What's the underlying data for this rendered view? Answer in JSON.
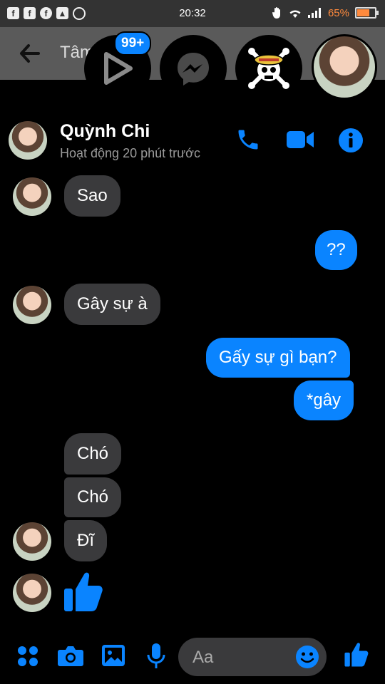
{
  "status_bar": {
    "time": "20:32",
    "battery_percent": "65%",
    "battery_level": 0.65,
    "notification_icons": [
      "facebook-icon",
      "facebook-icon",
      "facebook-circle-icon",
      "image-icon",
      "messenger-icon"
    ]
  },
  "top_bar": {
    "title": "Tâm",
    "badge_count": "99+"
  },
  "conversation": {
    "name": "Quỳnh Chi",
    "status": "Hoạt động 20 phút trước"
  },
  "messages": [
    {
      "dir": "in",
      "text": "Sao"
    },
    {
      "dir": "out",
      "text": "??"
    },
    {
      "dir": "in",
      "text": "Gây sự à"
    },
    {
      "dir": "out",
      "text": "Gấy sự gì bạn?"
    },
    {
      "dir": "out",
      "text": "*gây"
    },
    {
      "dir": "in",
      "text": "Chó"
    },
    {
      "dir": "in",
      "text": "Chó"
    },
    {
      "dir": "in",
      "text": "Đĩ"
    },
    {
      "dir": "in",
      "text": "thumbs-up"
    }
  ],
  "composer": {
    "placeholder": "Aa"
  },
  "colors": {
    "accent": "#0a84ff",
    "incoming_bubble": "#3a3a3c",
    "battery": "#ff8a3d"
  }
}
